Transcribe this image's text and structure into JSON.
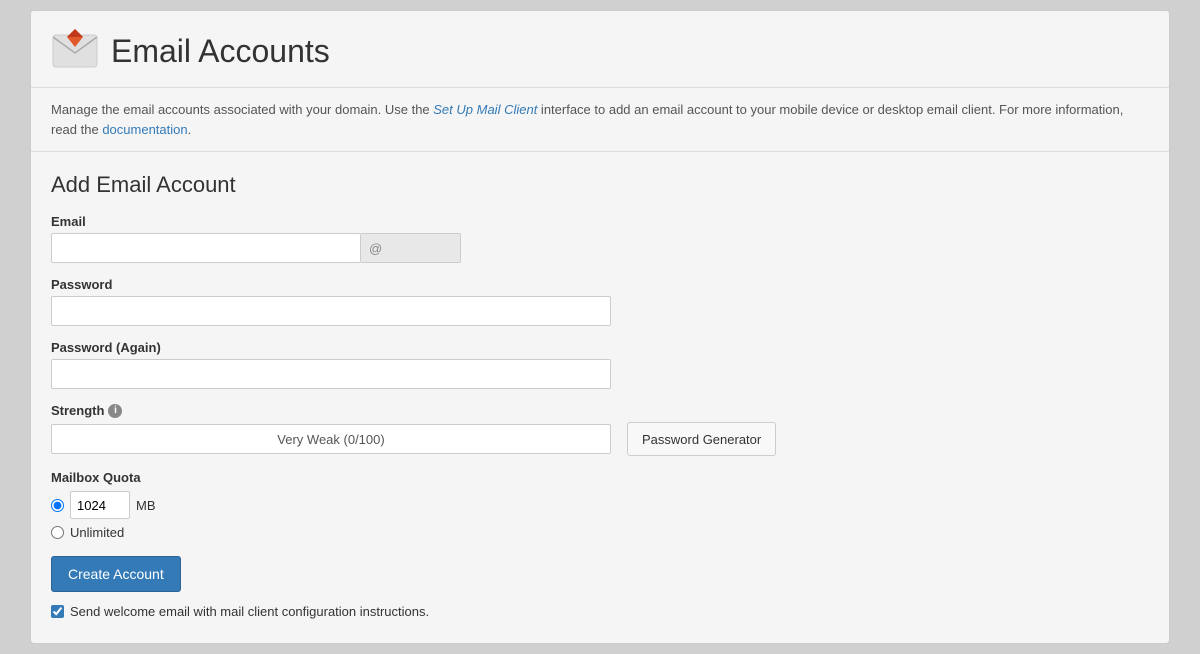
{
  "page": {
    "title": "Email Accounts"
  },
  "header": {
    "title": "Email Accounts"
  },
  "description": {
    "text_before": "Manage the email accounts associated with your domain. Use the ",
    "link_text": "Set Up Mail Client",
    "text_middle": " interface to add an email account to your mobile device or desktop email client. For more information, read the ",
    "doc_link_text": "documentation",
    "text_after": "."
  },
  "form": {
    "title": "Add Email Account",
    "email_label": "Email",
    "email_placeholder": "",
    "email_at_placeholder": "@",
    "password_label": "Password",
    "password_placeholder": "",
    "password_again_label": "Password (Again)",
    "password_again_placeholder": "",
    "strength_label": "Strength",
    "strength_text": "Very Weak (0/100)",
    "strength_percent": 0,
    "password_generator_label": "Password Generator",
    "quota_label": "Mailbox Quota",
    "quota_value": "1024",
    "quota_unit": "MB",
    "unlimited_label": "Unlimited",
    "create_button": "Create Account",
    "welcome_email_label": "Send welcome email with mail client configuration instructions."
  }
}
